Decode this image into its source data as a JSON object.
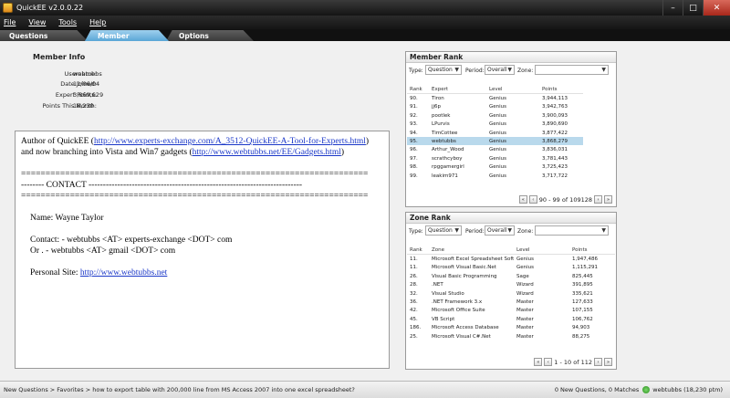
{
  "window": {
    "title": "QuickEE v2.0.0.22"
  },
  "menu": [
    "File",
    "View",
    "Tools",
    "Help"
  ],
  "tabs": [
    {
      "label": "Questions",
      "active": false
    },
    {
      "label": "Member",
      "active": true
    },
    {
      "label": "Options",
      "active": false
    }
  ],
  "member_info": {
    "title": "Member Info",
    "rows": [
      {
        "label": "Username:",
        "value": "webtubbs"
      },
      {
        "label": "Date Joined:",
        "value": "11/06/04"
      },
      {
        "label": "Expert Points:",
        "value": "3,869,629"
      },
      {
        "label": "Points This Month:",
        "value": "18,230"
      }
    ]
  },
  "bio": {
    "intro_text_1": "Author of QuickEE (",
    "link1": "http://www.experts-exchange.com/A_3512-QuickEE-A-Tool-for-Experts.html",
    "intro_text_2": ") and now branching into Vista and Win7 gadgets (",
    "link2": "http://www.webtubbs.net/EE/Gadgets.html",
    "intro_text_3": ")",
    "divider_1": "=======================================================================",
    "contact_line": "--------  CONTACT  --------------------------------------------------------------------------",
    "divider_2": "=======================================================================",
    "name": "Name: Wayne Taylor",
    "contact_1": "Contact: -  webtubbs <AT> experts-exchange <DOT> com",
    "contact_2": "Or         . - webtubbs <AT> gmail <DOT> com",
    "personal_label": "Personal Site: ",
    "personal_link": "http://www.webtubbs.net"
  },
  "member_rank": {
    "title": "Member Rank",
    "filters": {
      "type_label": "Type:",
      "type_value": "Question",
      "period_label": "Period:",
      "period_value": "Overall",
      "zone_label": "Zone:",
      "zone_value": ""
    },
    "columns": [
      "Rank",
      "Expert",
      "Level",
      "Points"
    ],
    "rows": [
      {
        "rank": "90.",
        "name": "Tiron",
        "level": "Genius",
        "points": "3,944,113",
        "selected": false
      },
      {
        "rank": "91.",
        "name": "jj6p",
        "level": "Genius",
        "points": "3,942,763",
        "selected": false
      },
      {
        "rank": "92.",
        "name": "pootlek",
        "level": "Genius",
        "points": "3,900,093",
        "selected": false
      },
      {
        "rank": "93.",
        "name": "LPurvis",
        "level": "Genius",
        "points": "3,890,690",
        "selected": false
      },
      {
        "rank": "94.",
        "name": "TimCottee",
        "level": "Genius",
        "points": "3,877,422",
        "selected": false
      },
      {
        "rank": "95.",
        "name": "webtubbs",
        "level": "Genius",
        "points": "3,868,279",
        "selected": true
      },
      {
        "rank": "96.",
        "name": "Arthur_Wood",
        "level": "Genius",
        "points": "3,836,031",
        "selected": false
      },
      {
        "rank": "97.",
        "name": "scrathcyboy",
        "level": "Genius",
        "points": "3,781,443",
        "selected": false
      },
      {
        "rank": "98.",
        "name": "rpggamergirl",
        "level": "Genius",
        "points": "3,725,423",
        "selected": false
      },
      {
        "rank": "99.",
        "name": "leakim971",
        "level": "Genius",
        "points": "3,717,722",
        "selected": false
      }
    ],
    "pager": "90 - 99 of 109128"
  },
  "zone_rank": {
    "title": "Zone Rank",
    "filters": {
      "type_label": "Type:",
      "type_value": "Question",
      "period_label": "Period:",
      "period_value": "Overall",
      "zone_label": "Zone:",
      "zone_value": ""
    },
    "columns": [
      "Rank",
      "Zone",
      "Level",
      "Points"
    ],
    "rows": [
      {
        "rank": "11.",
        "name": "Microsoft Excel Spreadsheet Softw...",
        "level": "Genius",
        "points": "1,947,486"
      },
      {
        "rank": "11.",
        "name": "Microsoft Visual Basic.Net",
        "level": "Genius",
        "points": "1,115,291"
      },
      {
        "rank": "26.",
        "name": "Visual Basic Programming",
        "level": "Sage",
        "points": "825,445"
      },
      {
        "rank": "28.",
        "name": ".NET",
        "level": "Wizard",
        "points": "391,895"
      },
      {
        "rank": "32.",
        "name": "Visual Studio",
        "level": "Wizard",
        "points": "335,621"
      },
      {
        "rank": "36.",
        "name": ".NET Framework 3.x",
        "level": "Master",
        "points": "127,633"
      },
      {
        "rank": "42.",
        "name": "Microsoft Office Suite",
        "level": "Master",
        "points": "107,155"
      },
      {
        "rank": "45.",
        "name": "VB Script",
        "level": "Master",
        "points": "106,762"
      },
      {
        "rank": "186.",
        "name": "Microsoft Access Database",
        "level": "Master",
        "points": "94,903"
      },
      {
        "rank": "25.",
        "name": "Microsoft Visual C#.Net",
        "level": "Master",
        "points": "88,275"
      }
    ],
    "pager": "1 - 10 of 112"
  },
  "statusbar": {
    "breadcrumb": "New Questions > Favorites > how to export table with 200,000 line from MS Access 2007 into one excel spreadsheet?",
    "counts": "0 New Questions, 0 Matches",
    "user": "webtubbs (18,230 ptm)"
  }
}
